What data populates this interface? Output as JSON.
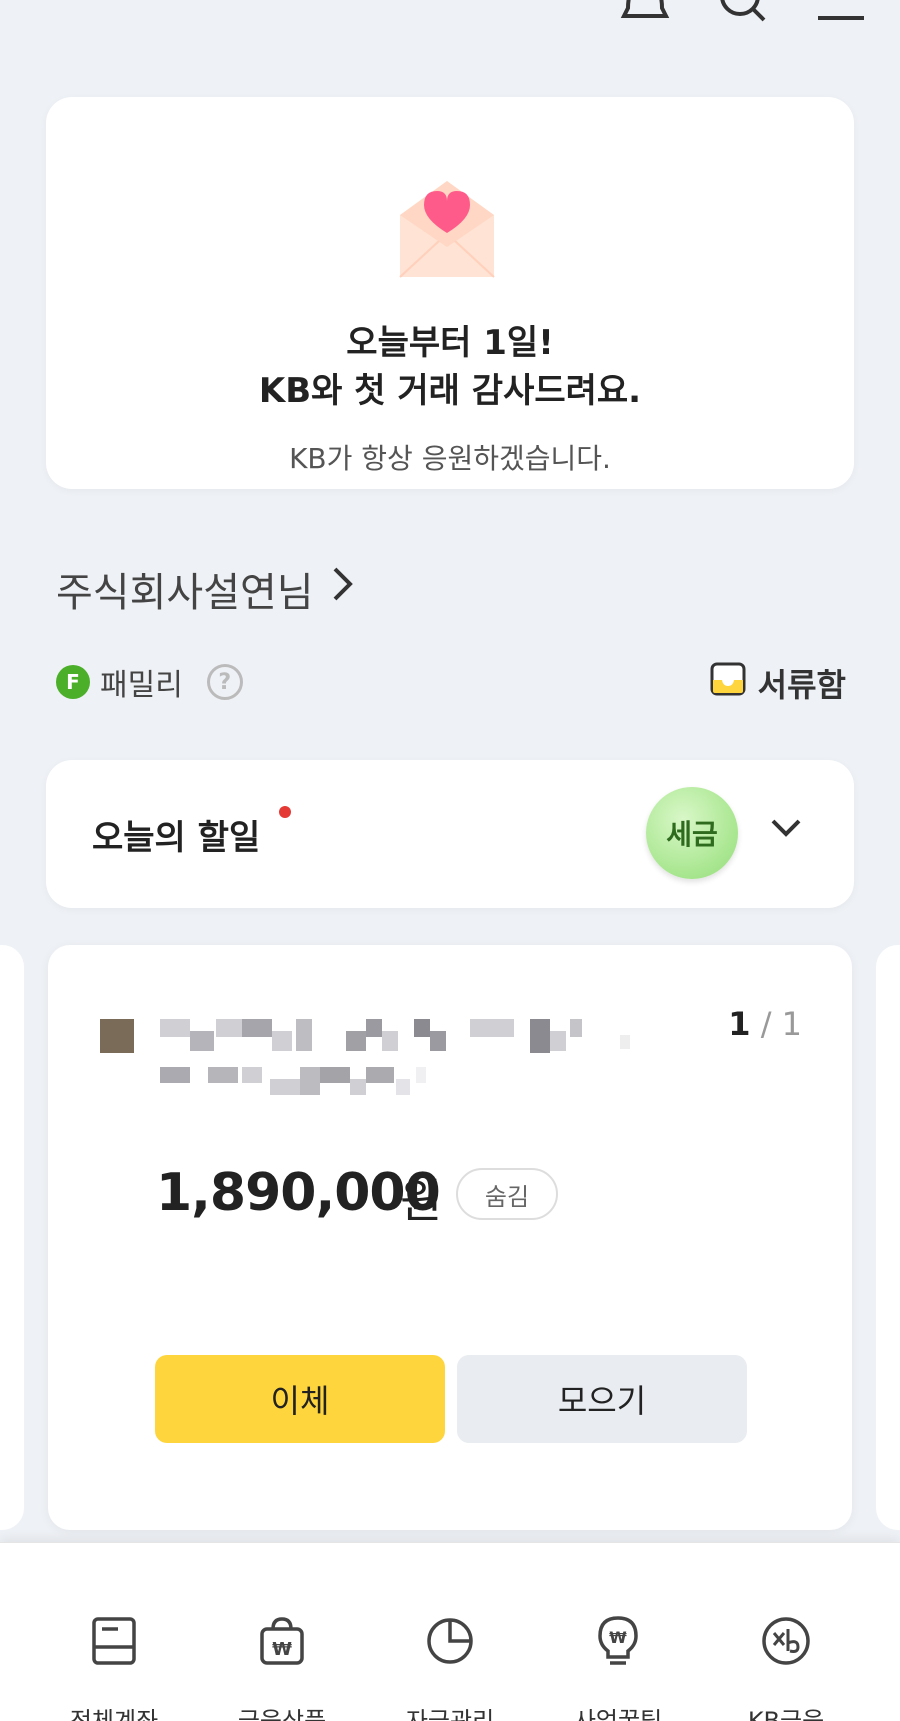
{
  "promo": {
    "line1": "오늘부터 1일!",
    "line2": "KB와 첫 거래 감사드려요.",
    "sub": "KB가 항상 응원하겠습니다."
  },
  "company": {
    "name": "주식회사설연님"
  },
  "family": {
    "badge": "F",
    "label": "패밀리",
    "help": "?"
  },
  "docbox": {
    "label": "서류함"
  },
  "todo": {
    "title": "오늘의 할일",
    "tax_label": "세금"
  },
  "account": {
    "pager_current": "1",
    "pager_total": "/ 1",
    "amount": "1,890,000",
    "currency": "원",
    "hide_label": "숨김",
    "transfer_label": "이체",
    "collect_label": "모으기"
  },
  "nav": [
    {
      "label": "전체계좌",
      "icon": "all-accounts-icon"
    },
    {
      "label": "금융상품",
      "icon": "financial-products-icon"
    },
    {
      "label": "자금관리",
      "icon": "fund-management-icon"
    },
    {
      "label": "사업꿀팁",
      "icon": "business-tips-icon"
    },
    {
      "label": "KB금융",
      "icon": "kb-finance-icon"
    }
  ],
  "colors": {
    "accent_yellow": "#ffd53d",
    "tax_green": "#a7e68e",
    "family_green": "#4caf2a",
    "alert_red": "#e53935"
  }
}
